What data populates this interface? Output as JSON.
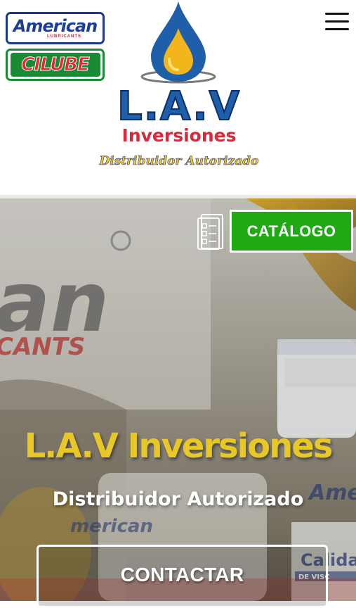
{
  "header": {
    "brands": [
      {
        "name": "American",
        "sub": "LUBRICANTS"
      },
      {
        "name": "CILUBE"
      }
    ],
    "logo": {
      "title": "L.A.V",
      "subtitle": "Inversiones",
      "tagline": "Distribuidor Autorizado"
    },
    "menu_icon": "hamburger-menu-icon"
  },
  "hero": {
    "catalog_label": "CATÁLOGO",
    "catalog_icon": "catalog-document-icon",
    "title": "L.A.V Inversiones",
    "subtitle": "Distribuidor Autorizado",
    "contact_label": "CONTACTAR",
    "background_texts": [
      "an",
      "CANTS",
      "Ame",
      "merican",
      "Calida",
      "DE VISC"
    ]
  },
  "colors": {
    "catalog_green": "#1faa14",
    "title_yellow": "#e8c829",
    "brand_blue": "#1f5ea9",
    "brand_red": "#d82a3a"
  }
}
